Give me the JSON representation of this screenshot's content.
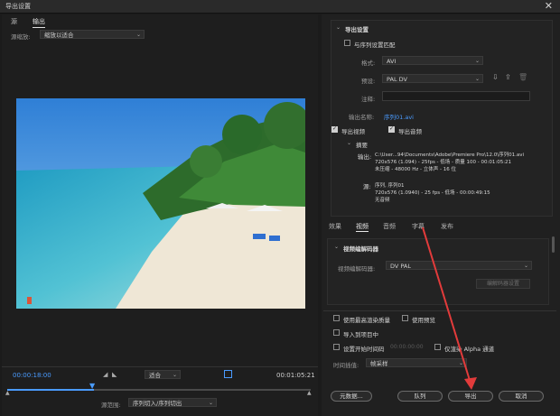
{
  "window": {
    "title": "导出设置"
  },
  "left": {
    "tabs": [
      "源",
      "输出"
    ],
    "active_tab": "输出",
    "source_scale_label": "源缩放:",
    "source_scale_value": "缩放以适合",
    "timecode_in": "00:00:18:00",
    "fit_value": "适合",
    "timecode_out": "00:01:05:21",
    "range_label": "源范围:",
    "range_value": "序列切入/序列切出"
  },
  "export_settings": {
    "header": "导出设置",
    "match_sequence_label": "与序列设置匹配",
    "format_label": "格式:",
    "format_value": "AVI",
    "preset_label": "预设:",
    "preset_value": "PAL DV",
    "comments_label": "注释:",
    "output_name_label": "输出名称:",
    "output_name_value": "序列01.avi",
    "export_video_label": "导出视频",
    "export_audio_label": "导出音频",
    "summary_header": "摘要",
    "output_label": "输出:",
    "output_line1": "C:\\User...94\\Documents\\Adobe\\Premiere  Pro\\12.0\\序列01.avi",
    "output_line2": "720x576 (1.094) - 25fps - 低场 - 质量 100 - 00:01:05:21",
    "output_line3": "未压缩 - 48000 Hz - 立体声 - 16 位",
    "source_label": "源:",
    "source_line1": "序列, 序列01",
    "source_line2": "720x576 (1.0940) - 25 fps - 低场 - 00:00:49:15",
    "source_line3": "无音频"
  },
  "tabs": {
    "items": [
      "效果",
      "视频",
      "音频",
      "字幕",
      "发布"
    ],
    "active": "视频"
  },
  "video_codec": {
    "header": "视频编解码器",
    "codec_label": "视频编解码器:",
    "codec_value": "DV PAL",
    "codec_settings_button": "编解码器设置"
  },
  "options": {
    "max_render_quality": "使用最高渲染质量",
    "use_previews": "使用预览",
    "import_into_project": "导入到项目中",
    "set_start_timecode": "设置开始时间码",
    "start_timecode_value": "00:00:00:00",
    "render_alpha_only": "仅渲染 Alpha 通道",
    "time_interpolation_label": "时间插值:",
    "time_interpolation_value": "帧采样"
  },
  "buttons": {
    "metadata": "元数据...",
    "queue": "队列",
    "export": "导出",
    "cancel": "取消"
  },
  "colors": {
    "accent_blue": "#4a9bff",
    "annotation_red": "#e23b3b"
  }
}
